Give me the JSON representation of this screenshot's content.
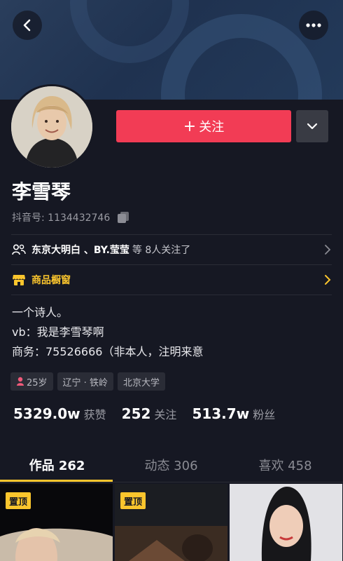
{
  "profile": {
    "name": "李雪琴",
    "uid": "抖音号: 1134432746",
    "follow_label": "关注",
    "bio": [
      "一个诗人。",
      "vb：我是李雪琴啊",
      "商务：75526666（非本人，注明来意"
    ],
    "tags": {
      "age": "25岁",
      "location": "辽宁 · 铁岭",
      "school": "北京大学"
    }
  },
  "friends": {
    "names": "东京大明白 、BY.莹莹",
    "tail": "等 8人关注了"
  },
  "shop": {
    "label": "商品橱窗"
  },
  "stats": [
    {
      "num": "5329.0w",
      "label": "获赞"
    },
    {
      "num": "252",
      "label": "关注"
    },
    {
      "num": "513.7w",
      "label": "粉丝"
    }
  ],
  "tabs": [
    "作品 262",
    "动态 306",
    "喜欢 458"
  ],
  "grid": {
    "pin_label": "置顶"
  },
  "colors": {
    "accent_red": "#f23c55",
    "accent_yellow": "#fac52d",
    "bg": "#161823"
  }
}
